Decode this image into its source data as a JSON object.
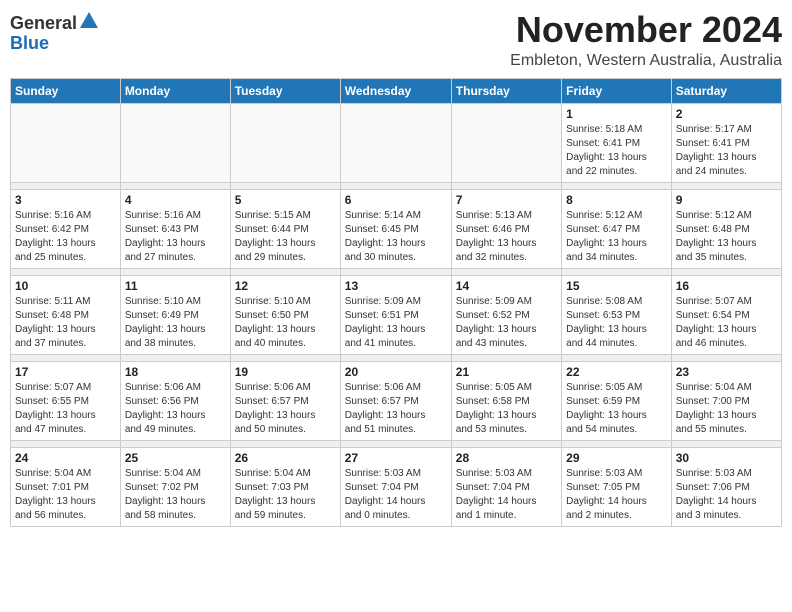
{
  "header": {
    "logo_general": "General",
    "logo_blue": "Blue",
    "month": "November 2024",
    "location": "Embleton, Western Australia, Australia"
  },
  "days_of_week": [
    "Sunday",
    "Monday",
    "Tuesday",
    "Wednesday",
    "Thursday",
    "Friday",
    "Saturday"
  ],
  "weeks": [
    [
      {
        "day": "",
        "info": ""
      },
      {
        "day": "",
        "info": ""
      },
      {
        "day": "",
        "info": ""
      },
      {
        "day": "",
        "info": ""
      },
      {
        "day": "",
        "info": ""
      },
      {
        "day": "1",
        "info": "Sunrise: 5:18 AM\nSunset: 6:41 PM\nDaylight: 13 hours\nand 22 minutes."
      },
      {
        "day": "2",
        "info": "Sunrise: 5:17 AM\nSunset: 6:41 PM\nDaylight: 13 hours\nand 24 minutes."
      }
    ],
    [
      {
        "day": "3",
        "info": "Sunrise: 5:16 AM\nSunset: 6:42 PM\nDaylight: 13 hours\nand 25 minutes."
      },
      {
        "day": "4",
        "info": "Sunrise: 5:16 AM\nSunset: 6:43 PM\nDaylight: 13 hours\nand 27 minutes."
      },
      {
        "day": "5",
        "info": "Sunrise: 5:15 AM\nSunset: 6:44 PM\nDaylight: 13 hours\nand 29 minutes."
      },
      {
        "day": "6",
        "info": "Sunrise: 5:14 AM\nSunset: 6:45 PM\nDaylight: 13 hours\nand 30 minutes."
      },
      {
        "day": "7",
        "info": "Sunrise: 5:13 AM\nSunset: 6:46 PM\nDaylight: 13 hours\nand 32 minutes."
      },
      {
        "day": "8",
        "info": "Sunrise: 5:12 AM\nSunset: 6:47 PM\nDaylight: 13 hours\nand 34 minutes."
      },
      {
        "day": "9",
        "info": "Sunrise: 5:12 AM\nSunset: 6:48 PM\nDaylight: 13 hours\nand 35 minutes."
      }
    ],
    [
      {
        "day": "10",
        "info": "Sunrise: 5:11 AM\nSunset: 6:48 PM\nDaylight: 13 hours\nand 37 minutes."
      },
      {
        "day": "11",
        "info": "Sunrise: 5:10 AM\nSunset: 6:49 PM\nDaylight: 13 hours\nand 38 minutes."
      },
      {
        "day": "12",
        "info": "Sunrise: 5:10 AM\nSunset: 6:50 PM\nDaylight: 13 hours\nand 40 minutes."
      },
      {
        "day": "13",
        "info": "Sunrise: 5:09 AM\nSunset: 6:51 PM\nDaylight: 13 hours\nand 41 minutes."
      },
      {
        "day": "14",
        "info": "Sunrise: 5:09 AM\nSunset: 6:52 PM\nDaylight: 13 hours\nand 43 minutes."
      },
      {
        "day": "15",
        "info": "Sunrise: 5:08 AM\nSunset: 6:53 PM\nDaylight: 13 hours\nand 44 minutes."
      },
      {
        "day": "16",
        "info": "Sunrise: 5:07 AM\nSunset: 6:54 PM\nDaylight: 13 hours\nand 46 minutes."
      }
    ],
    [
      {
        "day": "17",
        "info": "Sunrise: 5:07 AM\nSunset: 6:55 PM\nDaylight: 13 hours\nand 47 minutes."
      },
      {
        "day": "18",
        "info": "Sunrise: 5:06 AM\nSunset: 6:56 PM\nDaylight: 13 hours\nand 49 minutes."
      },
      {
        "day": "19",
        "info": "Sunrise: 5:06 AM\nSunset: 6:57 PM\nDaylight: 13 hours\nand 50 minutes."
      },
      {
        "day": "20",
        "info": "Sunrise: 5:06 AM\nSunset: 6:57 PM\nDaylight: 13 hours\nand 51 minutes."
      },
      {
        "day": "21",
        "info": "Sunrise: 5:05 AM\nSunset: 6:58 PM\nDaylight: 13 hours\nand 53 minutes."
      },
      {
        "day": "22",
        "info": "Sunrise: 5:05 AM\nSunset: 6:59 PM\nDaylight: 13 hours\nand 54 minutes."
      },
      {
        "day": "23",
        "info": "Sunrise: 5:04 AM\nSunset: 7:00 PM\nDaylight: 13 hours\nand 55 minutes."
      }
    ],
    [
      {
        "day": "24",
        "info": "Sunrise: 5:04 AM\nSunset: 7:01 PM\nDaylight: 13 hours\nand 56 minutes."
      },
      {
        "day": "25",
        "info": "Sunrise: 5:04 AM\nSunset: 7:02 PM\nDaylight: 13 hours\nand 58 minutes."
      },
      {
        "day": "26",
        "info": "Sunrise: 5:04 AM\nSunset: 7:03 PM\nDaylight: 13 hours\nand 59 minutes."
      },
      {
        "day": "27",
        "info": "Sunrise: 5:03 AM\nSunset: 7:04 PM\nDaylight: 14 hours\nand 0 minutes."
      },
      {
        "day": "28",
        "info": "Sunrise: 5:03 AM\nSunset: 7:04 PM\nDaylight: 14 hours\nand 1 minute."
      },
      {
        "day": "29",
        "info": "Sunrise: 5:03 AM\nSunset: 7:05 PM\nDaylight: 14 hours\nand 2 minutes."
      },
      {
        "day": "30",
        "info": "Sunrise: 5:03 AM\nSunset: 7:06 PM\nDaylight: 14 hours\nand 3 minutes."
      }
    ]
  ]
}
